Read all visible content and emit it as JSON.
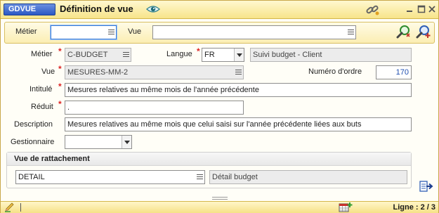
{
  "window": {
    "app_code": "GDVUE",
    "title": "Définition de vue"
  },
  "search": {
    "metier_label": "Métier",
    "metier_value": "",
    "vue_label": "Vue",
    "vue_value": ""
  },
  "form": {
    "metier_label": "Métier",
    "metier_value": "C-BUDGET",
    "langue_label": "Langue",
    "langue_value": "FR",
    "langue_description": "Suivi budget - Client",
    "vue_label": "Vue",
    "vue_value": "MESURES-MM-2",
    "numero_ordre_label": "Numéro d'ordre",
    "numero_ordre_value": "170",
    "intitule_label": "Intitulé",
    "intitule_value": "Mesures relatives au même mois de l'année précédente",
    "reduit_label": "Réduit",
    "reduit_value": ".",
    "description_label": "Description",
    "description_value": "Mesures relatives au même mois que celui saisi sur l'année précédente  liées aux buts",
    "gestionnaire_label": "Gestionnaire",
    "gestionnaire_value": "",
    "required_marker": "*"
  },
  "rattachement": {
    "header": "Vue de rattachement",
    "vue_value": "DETAIL",
    "vue_description": "Détail budget"
  },
  "status": {
    "line_label": "Ligne : 2 / 3"
  },
  "colors": {
    "titlebar": "#f7e48a",
    "badge": "#2b58c4",
    "required": "#dd2222",
    "number": "#1f4fb0"
  }
}
